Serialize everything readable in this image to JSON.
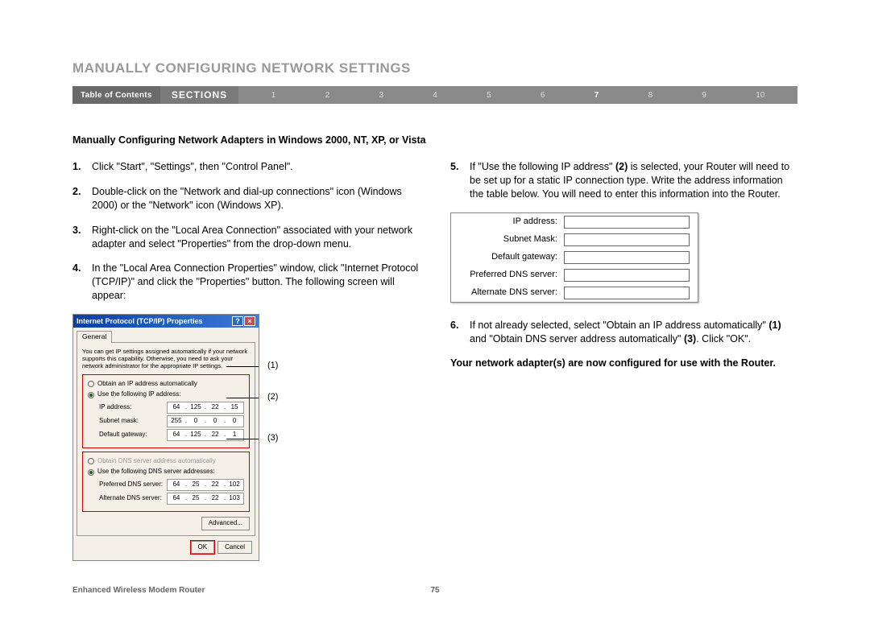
{
  "page_title": "MANUALLY CONFIGURING NETWORK SETTINGS",
  "nav": {
    "toc": "Table of Contents",
    "sections": "SECTIONS",
    "numbers": [
      "1",
      "2",
      "3",
      "4",
      "5",
      "6",
      "7",
      "8",
      "9",
      "10"
    ],
    "active": "7"
  },
  "subheading": "Manually Configuring Network Adapters in Windows 2000, NT, XP, or Vista",
  "left_steps": [
    {
      "n": "1.",
      "text": "Click \"Start\", \"Settings\", then \"Control Panel\"."
    },
    {
      "n": "2.",
      "text": "Double-click on the \"Network and dial-up connections\" icon (Windows 2000) or the \"Network\" icon (Windows XP)."
    },
    {
      "n": "3.",
      "text": "Right-click on the \"Local Area Connection\" associated with your network adapter and select \"Properties\" from the drop-down menu."
    },
    {
      "n": "4.",
      "text": "In the \"Local Area Connection Properties\" window, click \"Internet Protocol (TCP/IP)\" and click the \"Properties\" button. The following screen will appear:"
    }
  ],
  "right_steps": [
    {
      "n": "5.",
      "html": "If \"Use the following IP address\" <b>(2)</b> is selected, your Router will need to be set up for a static IP connection type. Write the address information the table below. You will need to enter this information into the Router."
    },
    {
      "n": "6.",
      "html": "If not already selected, select \"Obtain an IP address automatically\" <b>(1)</b> and \"Obtain DNS server address automatically\" <b>(3)</b>. Click \"OK\"."
    }
  ],
  "final_bold": "Your network adapter(s) are now configured for use with the Router.",
  "dialog": {
    "title": "Internet Protocol (TCP/IP) Properties",
    "help_icon": "?",
    "close_icon": "×",
    "tab": "General",
    "intro": "You can get IP settings assigned automatically if your network supports this capability. Otherwise, you need to ask your network administrator for the appropriate IP settings.",
    "radio_auto_ip": "Obtain an IP address automatically",
    "radio_use_ip": "Use the following IP address:",
    "ip_address_label": "IP address:",
    "ip_address": [
      "64",
      "125",
      "22",
      "15"
    ],
    "subnet_label": "Subnet mask:",
    "subnet": [
      "255",
      "0",
      "0",
      "0"
    ],
    "gateway_label": "Default gateway:",
    "gateway": [
      "64",
      "125",
      "22",
      "1"
    ],
    "radio_auto_dns": "Obtain DNS server address automatically",
    "radio_use_dns": "Use the following DNS server addresses:",
    "pref_dns_label": "Preferred DNS server:",
    "pref_dns": [
      "64",
      "25",
      "22",
      "102"
    ],
    "alt_dns_label": "Alternate DNS server:",
    "alt_dns": [
      "64",
      "25",
      "22",
      "103"
    ],
    "advanced": "Advanced...",
    "ok": "OK",
    "cancel": "Cancel"
  },
  "callouts": {
    "c1": "(1)",
    "c2": "(2)",
    "c3": "(3)"
  },
  "ipform": {
    "ip": "IP address:",
    "subnet": "Subnet Mask:",
    "gateway": "Default gateway:",
    "pref": "Preferred DNS server:",
    "alt": "Alternate DNS server:"
  },
  "footer": {
    "product": "Enhanced Wireless Modem Router",
    "page": "75"
  }
}
